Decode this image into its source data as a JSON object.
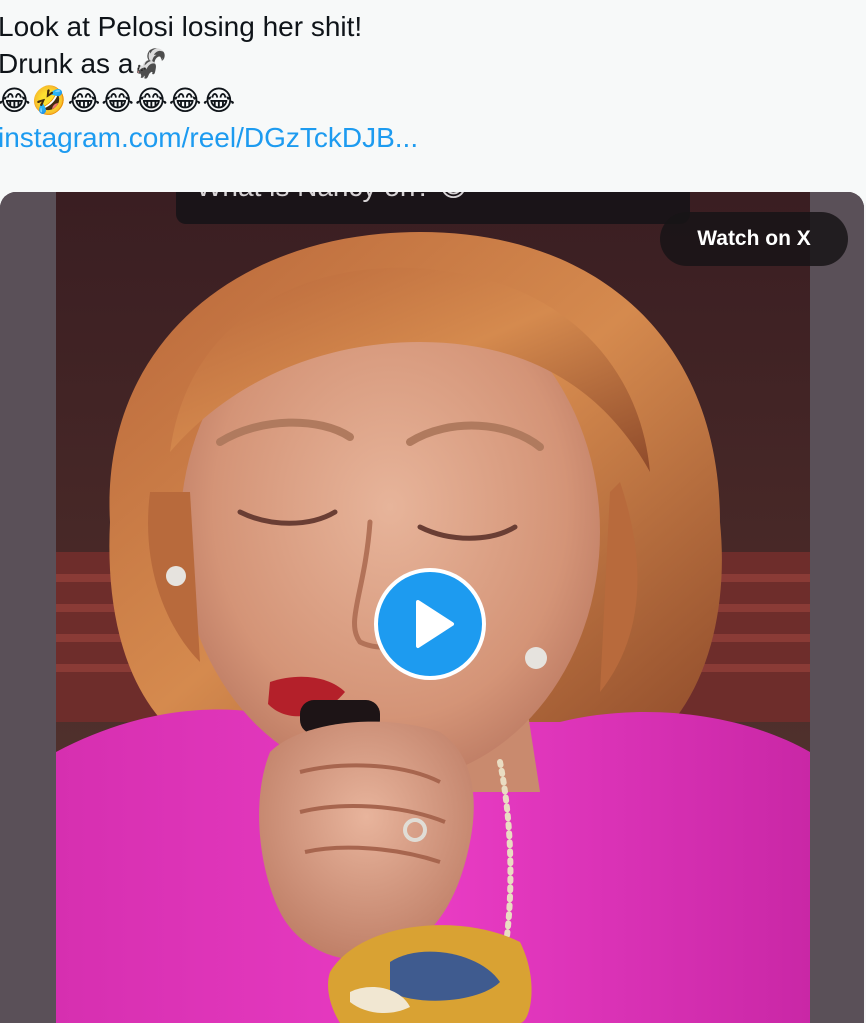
{
  "tweet": {
    "line1": "Look at Pelosi losing her shit!",
    "line2": "Drunk as a🦨",
    "emoji_row": "😂🤣😂😂😂😂😂",
    "link": "instagram.com/reel/DGzTckDJB..."
  },
  "media": {
    "caption": "What is Nancy on? 😅",
    "watch_label": "Watch on X",
    "play_icon": "play-icon"
  },
  "colors": {
    "link": "#1d9bf0",
    "play_button": "#1d9bf0",
    "text": "#0f1419"
  }
}
